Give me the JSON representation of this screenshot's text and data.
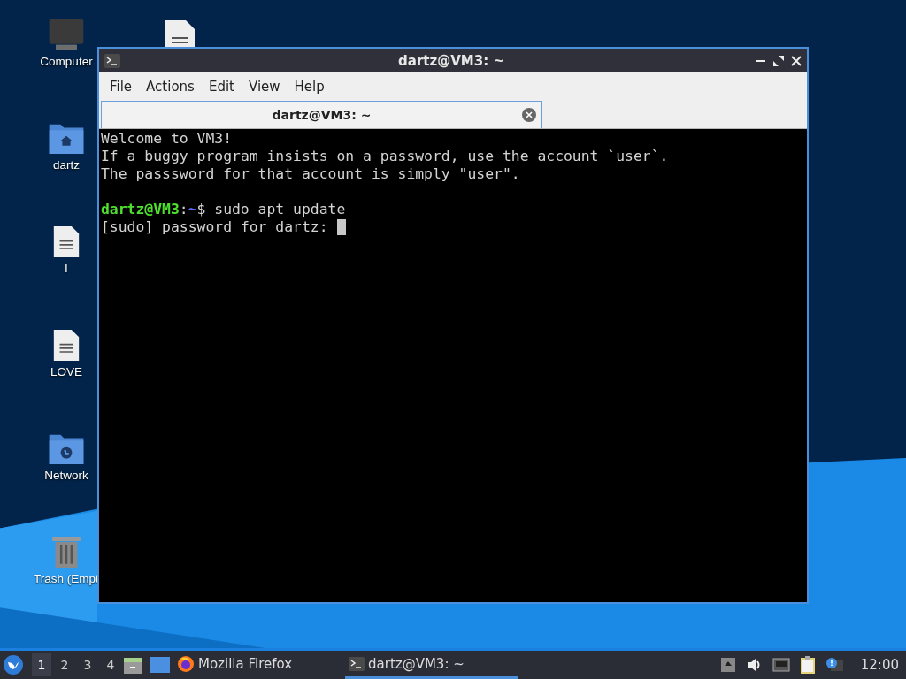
{
  "desktop_icons": [
    {
      "kind": "computer",
      "label": "Computer"
    },
    {
      "kind": "home-folder",
      "label": "dartz"
    },
    {
      "kind": "document",
      "label": "I"
    },
    {
      "kind": "document",
      "label": "LOVE"
    },
    {
      "kind": "network-folder",
      "label": "Network"
    },
    {
      "kind": "trash",
      "label": "Trash (Empt"
    }
  ],
  "window": {
    "title": "dartz@VM3: ~",
    "menu": [
      "File",
      "Actions",
      "Edit",
      "View",
      "Help"
    ],
    "tabs": [
      {
        "label": "dartz@VM3: ~",
        "selected": true
      }
    ],
    "terminal": {
      "lines": [
        {
          "kind": "text",
          "text": "Welcome to VM3!"
        },
        {
          "kind": "text",
          "text": "If a buggy program insists on a password, use the account `user`."
        },
        {
          "kind": "text",
          "text": "The passsword for that account is simply \"user\"."
        },
        {
          "kind": "blank"
        },
        {
          "kind": "prompt",
          "user": "dartz@VM3",
          "separator": ":",
          "path": "~",
          "symbol": "$",
          "command": "sudo apt update"
        },
        {
          "kind": "input",
          "text": "[sudo] password for dartz:"
        }
      ]
    }
  },
  "taskbar": {
    "workspaces": [
      {
        "label": "1",
        "selected": true
      },
      {
        "label": "2",
        "selected": false
      },
      {
        "label": "3",
        "selected": false
      },
      {
        "label": "4",
        "selected": false
      }
    ],
    "tasks": [
      {
        "kind": "firefox",
        "label": "Mozilla Firefox",
        "selected": false
      },
      {
        "kind": "terminal",
        "label": "dartz@VM3: ~",
        "selected": true
      }
    ],
    "clock": "12:00"
  }
}
